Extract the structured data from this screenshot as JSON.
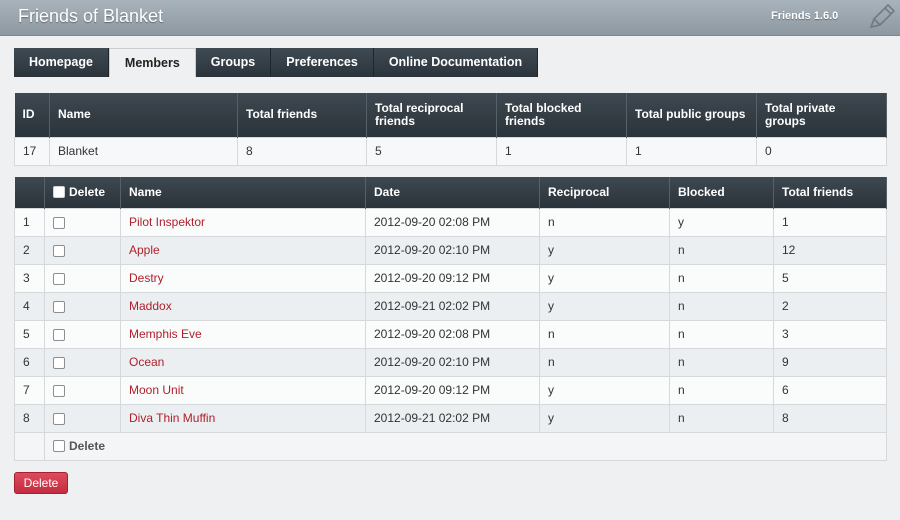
{
  "app": {
    "title": "Friends of Blanket",
    "version": "Friends 1.6.0"
  },
  "tabs": [
    {
      "label": "Homepage"
    },
    {
      "label": "Members"
    },
    {
      "label": "Groups"
    },
    {
      "label": "Preferences"
    },
    {
      "label": "Online Documentation"
    }
  ],
  "active_tab": "Members",
  "summary": {
    "headers": [
      "ID",
      "Name",
      "Total friends",
      "Total reciprocal friends",
      "Total blocked friends",
      "Total public groups",
      "Total private groups"
    ],
    "row": [
      "17",
      "Blanket",
      "8",
      "5",
      "1",
      "1",
      "0"
    ]
  },
  "members": {
    "headers": {
      "delete": "Delete",
      "name": "Name",
      "date": "Date",
      "reciprocal": "Reciprocal",
      "blocked": "Blocked",
      "total": "Total friends"
    },
    "rows": [
      {
        "num": "1",
        "name": "Pilot Inspektor",
        "date": "2012-09-20 02:08 PM",
        "reciprocal": "n",
        "blocked": "y",
        "total": "1"
      },
      {
        "num": "2",
        "name": "Apple",
        "date": "2012-09-20 02:10 PM",
        "reciprocal": "y",
        "blocked": "n",
        "total": "12"
      },
      {
        "num": "3",
        "name": "Destry",
        "date": "2012-09-20 09:12 PM",
        "reciprocal": "y",
        "blocked": "n",
        "total": "5"
      },
      {
        "num": "4",
        "name": "Maddox",
        "date": "2012-09-21 02:02 PM",
        "reciprocal": "y",
        "blocked": "n",
        "total": "2"
      },
      {
        "num": "5",
        "name": "Memphis Eve",
        "date": "2012-09-20 02:08 PM",
        "reciprocal": "n",
        "blocked": "n",
        "total": "3"
      },
      {
        "num": "6",
        "name": "Ocean",
        "date": "2012-09-20 02:10 PM",
        "reciprocal": "n",
        "blocked": "n",
        "total": "9"
      },
      {
        "num": "7",
        "name": "Moon Unit",
        "date": "2012-09-20 09:12 PM",
        "reciprocal": "y",
        "blocked": "n",
        "total": "6"
      },
      {
        "num": "8",
        "name": "Diva Thin Muffin",
        "date": "2012-09-21 02:02 PM",
        "reciprocal": "y",
        "blocked": "n",
        "total": "8"
      }
    ],
    "footer_delete_label": "Delete"
  },
  "delete_button": "Delete",
  "colors": {
    "accent": "#c32c3f",
    "header_dark": "#2b333a",
    "link": "#b0202c"
  },
  "icons": {
    "title_right": "pencil-icon"
  }
}
